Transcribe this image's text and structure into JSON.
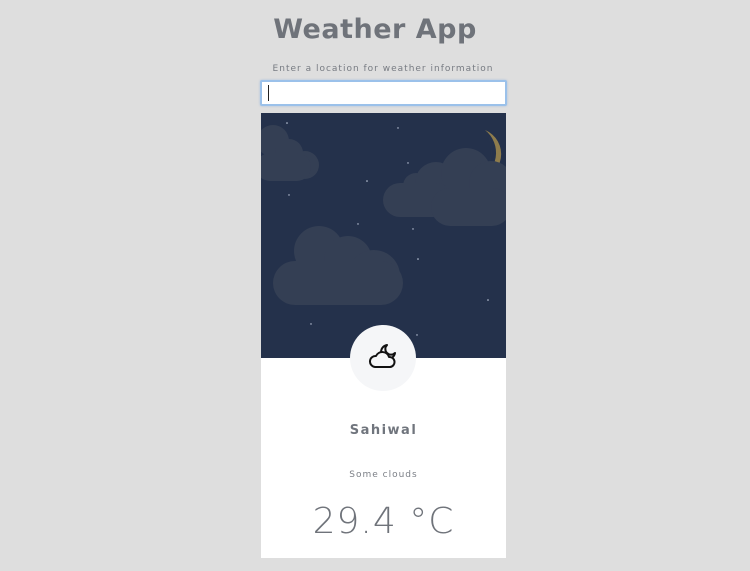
{
  "header": {
    "title": "Weather App"
  },
  "search": {
    "label": "Enter a location for weather information",
    "value": "",
    "placeholder": ""
  },
  "weather": {
    "sky_scene": "night-sky-moon-clouds",
    "icon": "partly-cloudy-night-icon",
    "city": "Sahiwal",
    "condition": "Some clouds",
    "temperature": "29.4 °C"
  },
  "colors": {
    "page_background": "#dedede",
    "sky_background": "#24314b",
    "cloud": "#343f54",
    "moon": "#f7d66f",
    "text": "#6f737a",
    "input_border": "#9bc1ea"
  }
}
